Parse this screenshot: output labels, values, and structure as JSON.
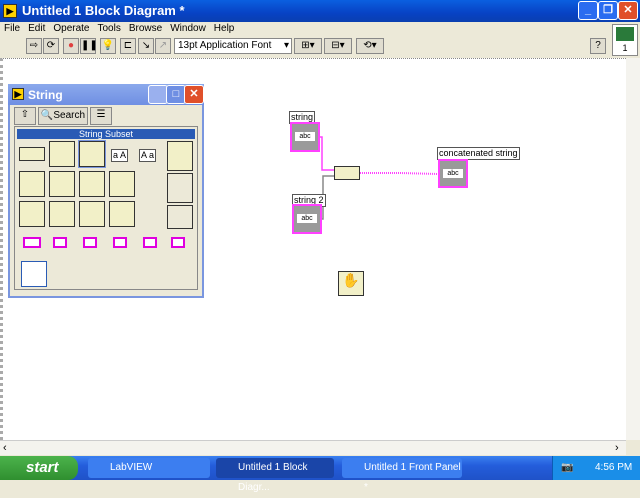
{
  "window": {
    "title": "Untitled 1 Block Diagram *"
  },
  "menu": [
    "File",
    "Edit",
    "Operate",
    "Tools",
    "Browse",
    "Window",
    "Help"
  ],
  "toolbar": {
    "font": "13pt Application Font",
    "icons": [
      "run-arrow",
      "run-continuous",
      "abort",
      "pause",
      "highlight-execution",
      "retain-wire-values",
      "step-into",
      "step-out",
      "align",
      "distribute",
      "reorder",
      "help"
    ],
    "connector_pane_number": "1"
  },
  "palette": {
    "title": "String",
    "search_label": "Search",
    "subset_title": "String Subset",
    "case_labels": [
      "a A",
      "A a"
    ]
  },
  "diagram": {
    "controls": [
      {
        "label": "string",
        "value": "abc"
      },
      {
        "label": "string 2",
        "value": "abc"
      }
    ],
    "indicator": {
      "label": "concatenated string",
      "value": "abc"
    },
    "wire_color": "#ff40ff"
  },
  "taskbar": {
    "start": "start",
    "tasks": [
      "LabVIEW",
      "Untitled 1 Block Diagr...",
      "Untitled 1 Front Panel *"
    ],
    "clock": "4:56 PM"
  }
}
